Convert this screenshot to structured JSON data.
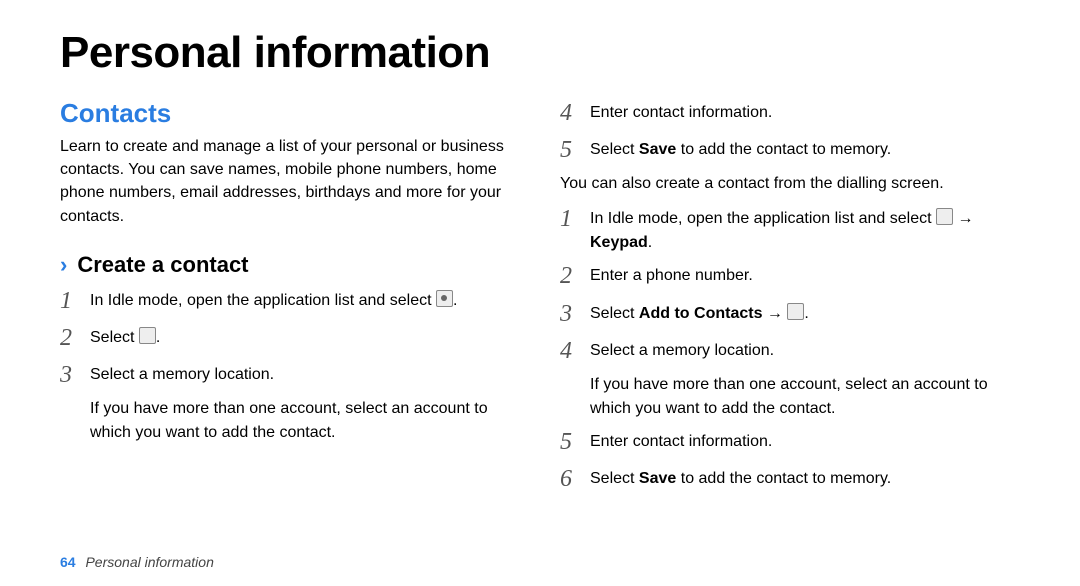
{
  "title": "Personal information",
  "section": {
    "heading": "Contacts",
    "intro": "Learn to create and manage a list of your personal or business contacts. You can save names, mobile phone numbers, home phone numbers, email addresses, birthdays and more for your contacts."
  },
  "subhead": "Create a contact",
  "stepsA": {
    "s1": "In Idle mode, open the application list and select ",
    "s1_end": ".",
    "s2": "Select ",
    "s2_end": ".",
    "s3": "Select a memory location.",
    "s3_sub": "If you have more than one account, select an account to which you want to add the contact.",
    "s4": "Enter contact information.",
    "s5a": "Select ",
    "s5b": "Save",
    "s5c": " to add the contact to memory."
  },
  "bridge_text": "You can also create a contact from the dialling screen.",
  "stepsB": {
    "s1a": "In Idle mode, open the application list and select ",
    "s1b": " → ",
    "s1c": "Keypad",
    "s1d": ".",
    "s2": "Enter a phone number.",
    "s3a": "Select ",
    "s3b": "Add to Contacts",
    "s3c": " → ",
    "s3d": ".",
    "s4": "Select a memory location.",
    "s4_sub": "If you have more than one account, select an account to which you want to add the contact.",
    "s5": "Enter contact information.",
    "s6a": "Select ",
    "s6b": "Save",
    "s6c": " to add the contact to memory."
  },
  "footer": {
    "page_number": "64",
    "label": "Personal information"
  },
  "chevron_glyph": "›"
}
